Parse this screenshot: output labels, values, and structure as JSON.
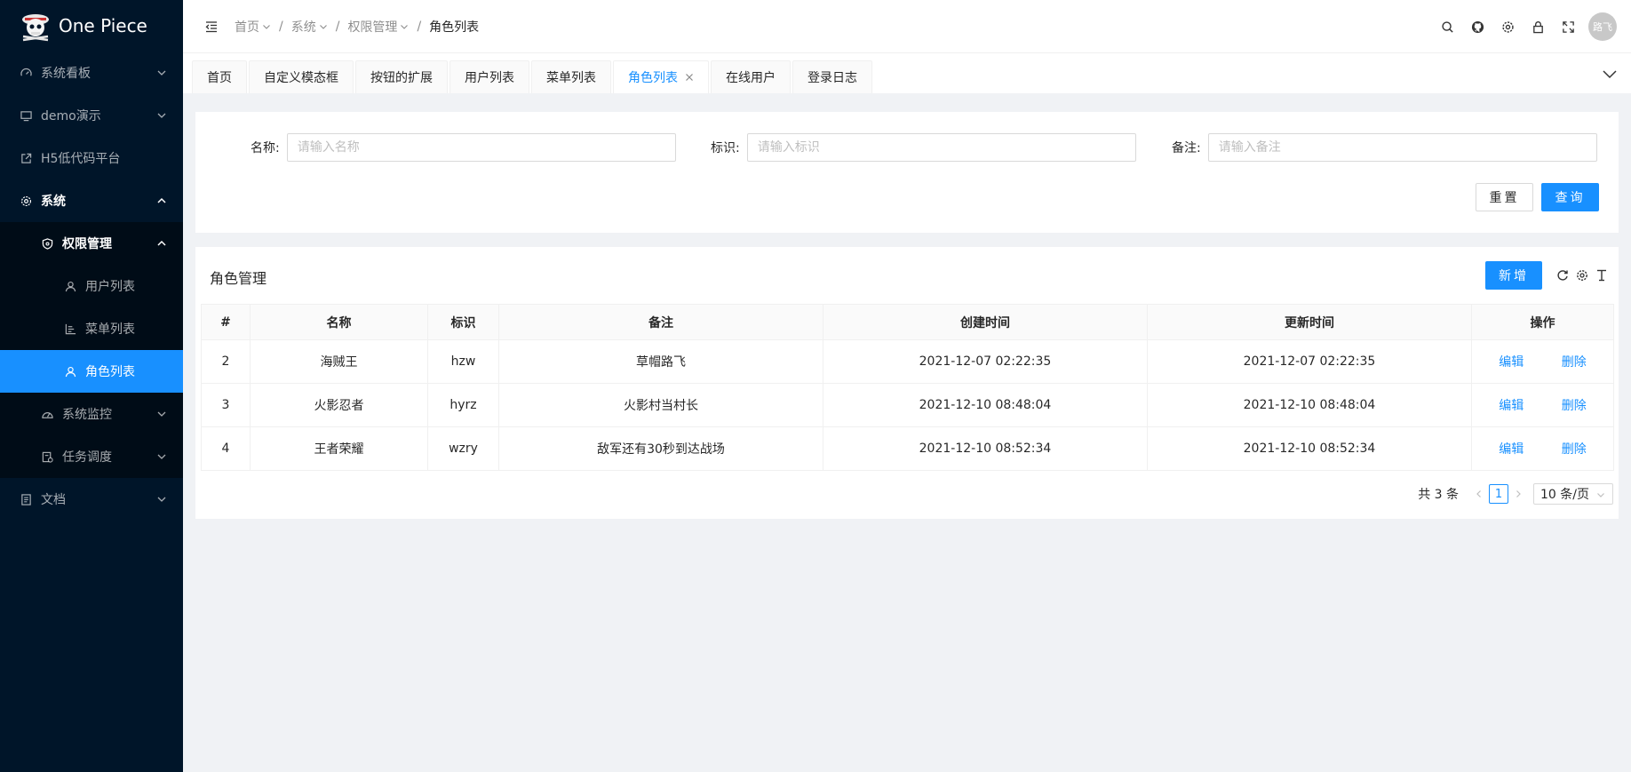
{
  "app": {
    "title": "One Piece"
  },
  "sidebar": {
    "items": [
      {
        "label": "系统看板",
        "icon": "dashboard-icon"
      },
      {
        "label": "demo演示",
        "icon": "desktop-icon"
      },
      {
        "label": "H5低代码平台",
        "icon": "external-link-icon"
      },
      {
        "label": "系统",
        "icon": "setting-icon"
      },
      {
        "label": "权限管理",
        "icon": "safety-icon"
      },
      {
        "label": "用户列表",
        "icon": "user-icon"
      },
      {
        "label": "菜单列表",
        "icon": "chart-icon"
      },
      {
        "label": "角色列表",
        "icon": "user-icon"
      },
      {
        "label": "系统监控",
        "icon": "monitor-icon"
      },
      {
        "label": "任务调度",
        "icon": "schedule-icon"
      },
      {
        "label": "文档",
        "icon": "doc-icon"
      }
    ]
  },
  "breadcrumb": [
    "首页",
    "系统",
    "权限管理",
    "角色列表"
  ],
  "header": {
    "avatar_text": "路飞"
  },
  "tabs": [
    "首页",
    "自定义模态框",
    "按钮的扩展",
    "用户列表",
    "菜单列表",
    "角色列表",
    "在线用户",
    "登录日志"
  ],
  "search": {
    "name_label": "名称:",
    "name_placeholder": "请输入名称",
    "code_label": "标识:",
    "code_placeholder": "请输入标识",
    "remark_label": "备注:",
    "remark_placeholder": "请输入备注",
    "reset_label": "重置",
    "query_label": "查询"
  },
  "table": {
    "title": "角色管理",
    "add_label": "新增",
    "columns": [
      "#",
      "名称",
      "标识",
      "备注",
      "创建时间",
      "更新时间",
      "操作"
    ],
    "rows": [
      [
        "2",
        "海贼王",
        "hzw",
        "草帽路飞",
        "2021-12-07 02:22:35",
        "2021-12-07 02:22:35"
      ],
      [
        "3",
        "火影忍者",
        "hyrz",
        "火影村当村长",
        "2021-12-10 08:48:04",
        "2021-12-10 08:48:04"
      ],
      [
        "4",
        "王者荣耀",
        "wzry",
        "敌军还有30秒到达战场",
        "2021-12-10 08:52:34",
        "2021-12-10 08:52:34"
      ]
    ],
    "edit_label": "编辑",
    "delete_label": "删除"
  },
  "pagination": {
    "total_text": "共 3 条",
    "current_page": "1",
    "page_size": "10 条/页"
  },
  "colors": {
    "sidebar_bg": "#001529",
    "accent": "#1890ff",
    "submenu_bg": "#000c17"
  }
}
